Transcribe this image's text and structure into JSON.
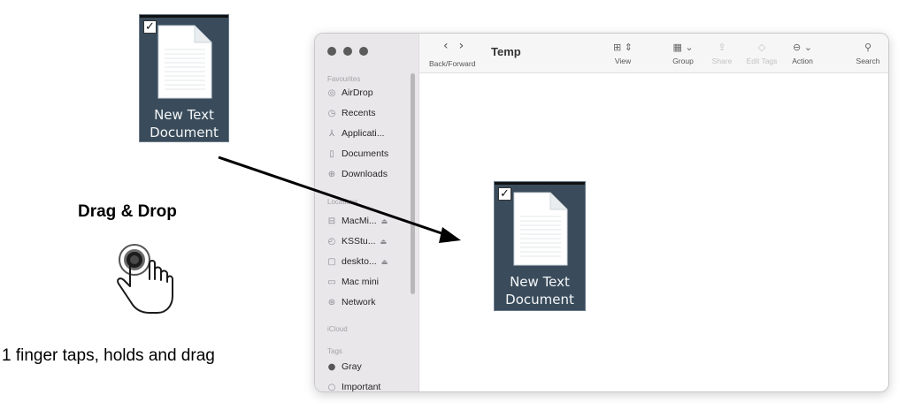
{
  "annotation": {
    "title": "Drag & Drop",
    "caption": "1 finger taps, holds and drag"
  },
  "source_file": {
    "checkbox": "✓",
    "label_line1": "New Text",
    "label_line2": "Document"
  },
  "dropped_file": {
    "checkbox": "✓",
    "label_line1": "New Text",
    "label_line2": "Document"
  },
  "finder": {
    "title": "Temp",
    "nav_label": "Back/Forward",
    "toolbar": {
      "view": "View",
      "group": "Group",
      "share": "Share",
      "edit_tags": "Edit Tags",
      "action": "Action",
      "search": "Search"
    },
    "sidebar": {
      "favourites_label": "Favourites",
      "favourites": [
        "AirDrop",
        "Recents",
        "Applicati...",
        "Documents",
        "Downloads"
      ],
      "locations_label": "Locations",
      "locations": [
        "MacMi...",
        "KSStu...",
        "deskto...",
        "Mac mini",
        "Network"
      ],
      "icloud_label": "iCloud",
      "tags_label": "Tags",
      "tags": [
        "Gray",
        "Important"
      ]
    }
  },
  "colors": {
    "file_tile_bg": "#3a4c5b",
    "sidebar_bg": "#eae7eb",
    "arrow": "#000000"
  }
}
